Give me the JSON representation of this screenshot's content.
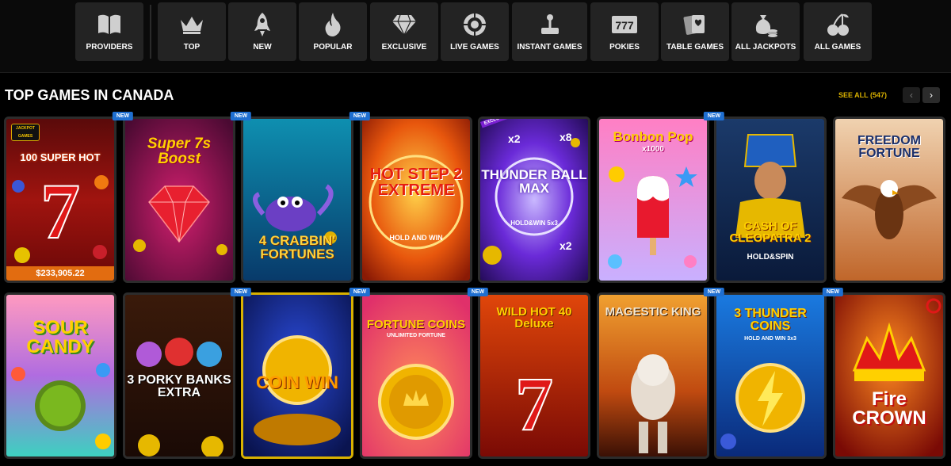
{
  "nav": {
    "categories": [
      {
        "label": "PROVIDERS",
        "icon": "book-icon"
      },
      {
        "label": "TOP",
        "icon": "crown-icon"
      },
      {
        "label": "NEW",
        "icon": "rocket-icon"
      },
      {
        "label": "POPULAR",
        "icon": "flame-icon"
      },
      {
        "label": "EXCLUSIVE",
        "icon": "diamond-icon"
      },
      {
        "label": "LIVE GAMES",
        "icon": "roulette-icon"
      },
      {
        "label": "INSTANT GAMES",
        "icon": "joystick-icon"
      },
      {
        "label": "POKIES",
        "icon": "slot-777-icon"
      },
      {
        "label": "TABLE GAMES",
        "icon": "cards-icon"
      },
      {
        "label": "ALL JACKPOTS",
        "icon": "money-bag-icon"
      },
      {
        "label": "ALL GAMES",
        "icon": "cherries-icon"
      }
    ]
  },
  "section": {
    "title": "TOP GAMES IN CANADA",
    "see_all": "SEE ALL (547)",
    "prev_icon": "chevron-left-icon",
    "next_icon": "chevron-right-icon"
  },
  "badges": {
    "new": "NEW",
    "exclusive": "EXCLUSIVE"
  },
  "games": [
    {
      "title": "100 SUPER HOT",
      "jackpot": "$233,905.22",
      "provider_badge": "JACKPOT GAMES",
      "new": false
    },
    {
      "title": "Super 7s Boost",
      "new": true
    },
    {
      "title": "4 CRABBIN' FORTUNES",
      "new": true
    },
    {
      "title": "HOT STEP 2 EXTREME",
      "subtitle": "HOLD AND WIN",
      "new": true
    },
    {
      "title": "THUNDER BALL MAX",
      "subtitle": "HOLD&WIN 5x3",
      "exclusive": true,
      "new": false
    },
    {
      "title": "Bonbon Pop",
      "subtitle": "x1000",
      "new": false
    },
    {
      "title": "CASH OF CLEOPATRA 2",
      "subtitle": "HOLD&SPIN",
      "new": true
    },
    {
      "title": "FREEDOM FORTUNE",
      "new": false
    },
    {
      "title": "SOUR CANDY",
      "new": false
    },
    {
      "title": "3 PORKY BANKS EXTRA",
      "new": false
    },
    {
      "title": "COIN WIN",
      "new": true
    },
    {
      "title": "FORTUNE COINS",
      "subtitle": "UNLIMITED FORTUNE",
      "new": true
    },
    {
      "title": "WILD HOT 40 Deluxe",
      "new": true
    },
    {
      "title": "MAGESTIC KING",
      "new": false
    },
    {
      "title": "3 THUNDER COINS",
      "subtitle": "HOLD AND WIN 3x3",
      "new": true
    },
    {
      "title": "Fire CROWN",
      "new": true
    }
  ],
  "colors": {
    "accent_gold": "#d9b100",
    "new_badge": "#1f6fd1",
    "nav_tile": "#232323",
    "jackpot_bar": "#e26c10"
  }
}
